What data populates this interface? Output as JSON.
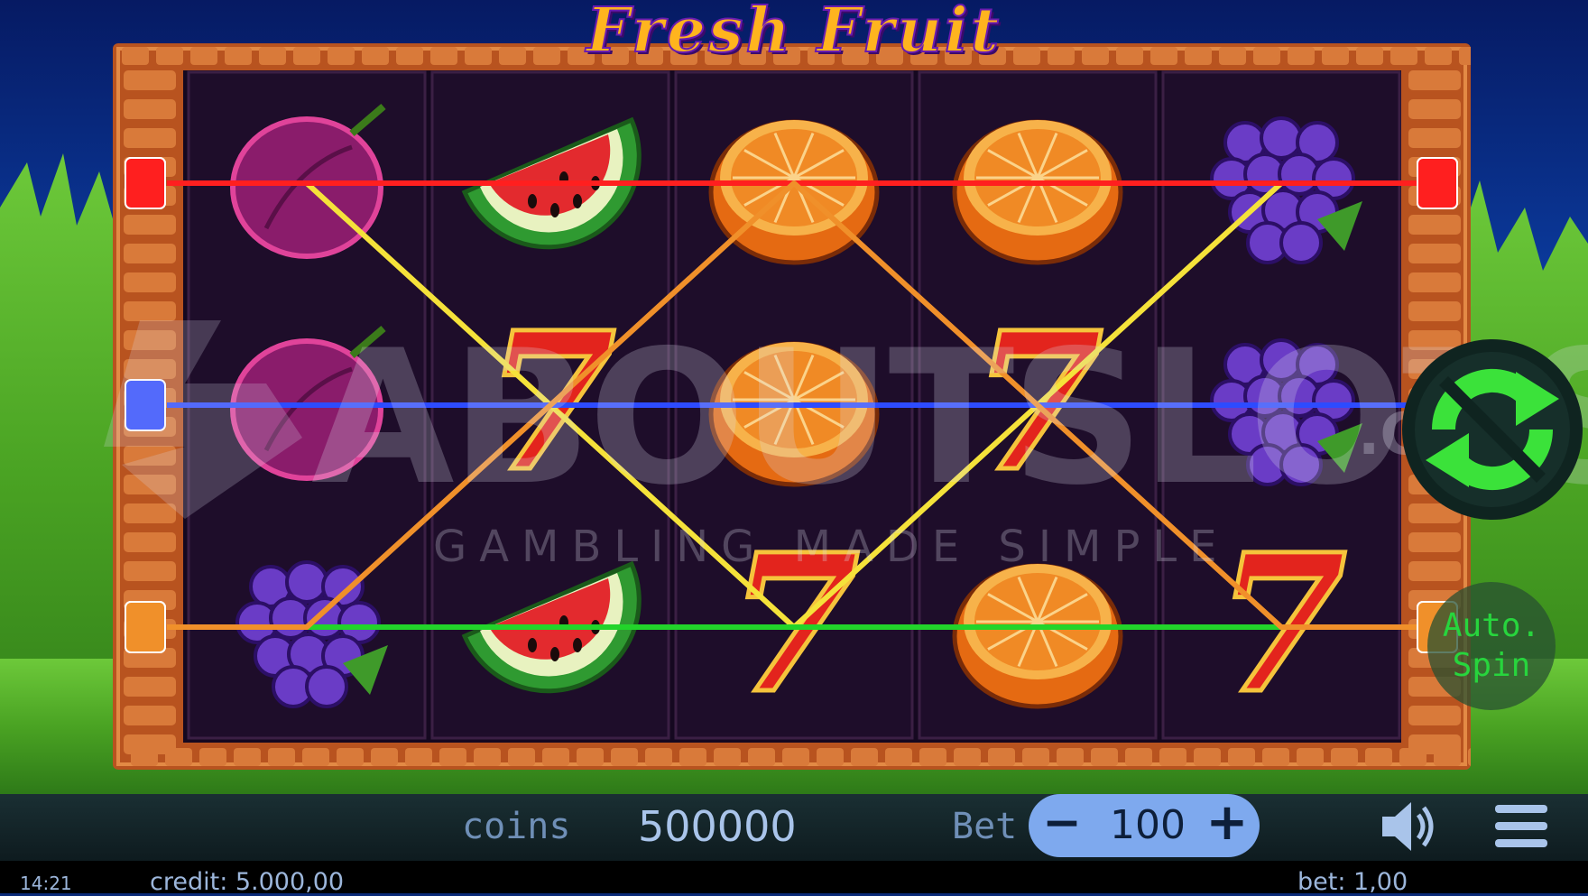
{
  "game": {
    "title": "Fresh Fruit"
  },
  "watermark": {
    "brand": "ABOUTSLOTS",
    "suffix": ".COM",
    "tagline": "GAMBLING MADE SIMPLE"
  },
  "reels": [
    [
      "plum",
      "plum",
      "grapes"
    ],
    [
      "watermelon",
      "seven",
      "watermelon"
    ],
    [
      "orange",
      "orange",
      "seven"
    ],
    [
      "orange",
      "seven",
      "orange"
    ],
    [
      "grapes",
      "grapes",
      "seven"
    ]
  ],
  "paylines": [
    {
      "color": "#f5e23a",
      "row_path": [
        0,
        1,
        2,
        1,
        0
      ]
    },
    {
      "color": "#ff1f1f",
      "row_path": [
        0,
        0,
        0,
        0,
        0
      ]
    },
    {
      "color": "#2d4bff",
      "row_path": [
        1,
        1,
        1,
        1,
        1
      ]
    },
    {
      "color": "#22d42a",
      "row_path": [
        2,
        2,
        2,
        2,
        2
      ]
    },
    {
      "color": "#f0902a",
      "row_path": [
        2,
        1,
        0,
        1,
        2
      ]
    }
  ],
  "controls": {
    "coins_label": "coins",
    "coins_value": "500000",
    "bet_label": "Bet",
    "bet_value": "100",
    "auto_spin_line1": "Auto.",
    "auto_spin_line2": "Spin",
    "spin_icon": "refresh-arrows-icon",
    "sound_icon": "speaker-icon",
    "menu_icon": "hamburger-menu-icon"
  },
  "status": {
    "time": "14:21",
    "credit": "credit: 5.000,00",
    "bet": "bet: 1,00"
  },
  "colors": {
    "frame_wood": "#c7632a",
    "reel_bg": "#1a0b24",
    "accent_green": "#27d53d",
    "bet_pill": "#7ea9ee"
  }
}
